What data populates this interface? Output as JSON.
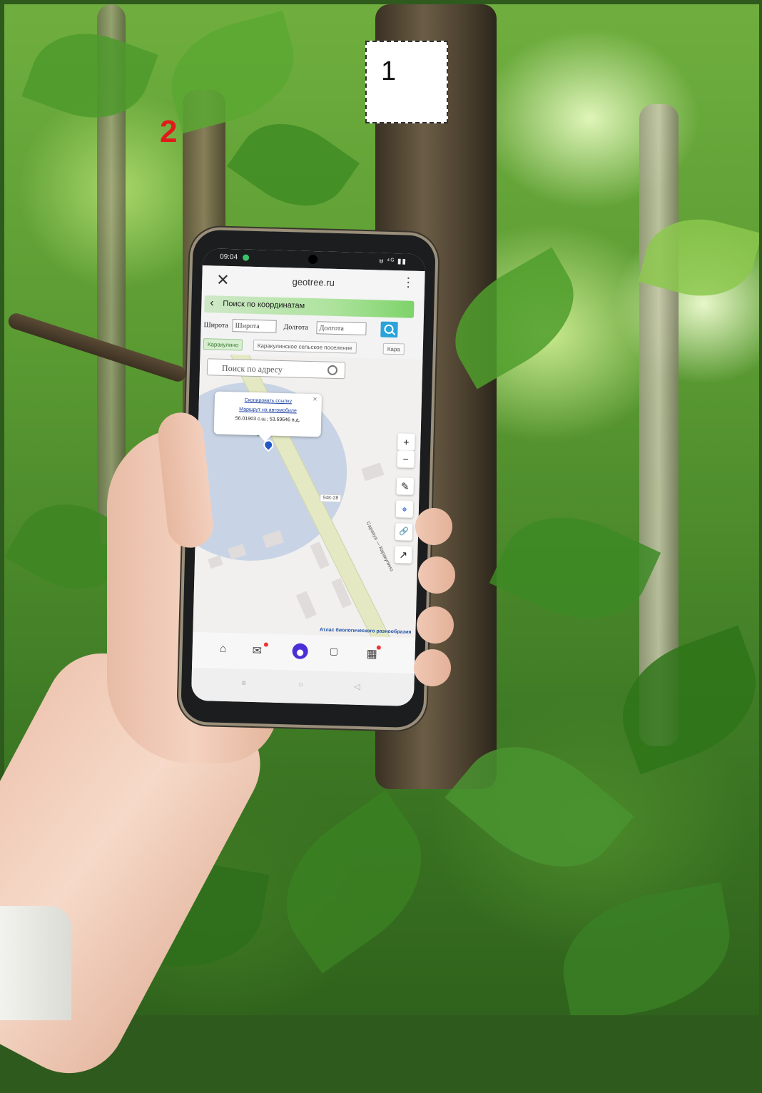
{
  "labels": {
    "box_number": "1",
    "marker_number": "2"
  },
  "phone": {
    "status": {
      "time": "09:04",
      "right": "ᵾ ⁴ᴳ ▮▮"
    },
    "browser": {
      "url": "geotree.ru",
      "close_icon": "close-icon",
      "menu_icon": "more-vert-icon"
    },
    "coord_search": {
      "title": "Поиск по координатам",
      "lat_label": "Широта",
      "lat_placeholder": "Широта",
      "lon_label": "Долгота",
      "lon_placeholder": "Долгота"
    },
    "chips": [
      "Каракулино",
      "Каракулинское сельское поселение",
      "Кара"
    ],
    "map": {
      "address_placeholder": "Поиск по адресу",
      "popup": {
        "copy_link": "Скопировать ссылку",
        "route": "Маршрут на автомобиле",
        "coords": "56.01903 с.ш.; 53.69646 в.д."
      },
      "road_label": "94К-28",
      "road_name": "Сарапул — Каракулино",
      "attribution": "Атлас биологического разнообразия",
      "controls": [
        "+",
        "−",
        "✎",
        "⌖",
        "🔗",
        "↗"
      ]
    },
    "colors": {
      "accent": "#2aa3d8",
      "coord_bar": "#7ed36a",
      "alice": "#4b2fd6"
    }
  }
}
